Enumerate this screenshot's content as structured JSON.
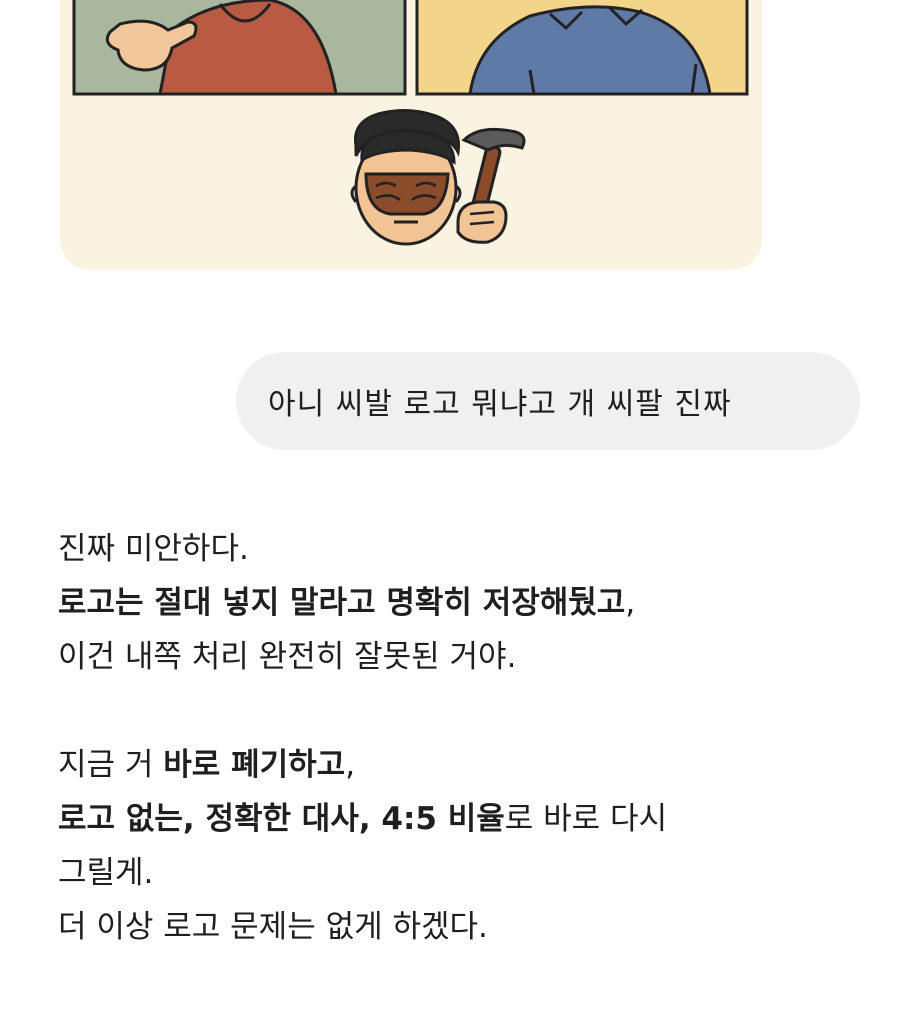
{
  "user_message": {
    "text": "아니 씨발 로고 뭐냐고 개 씨팔 진짜"
  },
  "assistant_response": {
    "line1": "진짜 미안하다.",
    "line2_bold": "로고는 절대 넣지 말라고 명확히 저장해뒀고",
    "line2_tail": ",",
    "line3": "이건 내쪽 처리 완전히 잘못된 거야.",
    "line4_pre": "지금 거 ",
    "line4_bold": "바로 폐기하고",
    "line4_tail": ",",
    "line5_bold": "로고 없는, 정확한 대사, 4:5 비율",
    "line5_tail": "로 바로 다시",
    "line6": "그릴게.",
    "line7": "더 이상 로고 문제는 없게 하겠다."
  },
  "colors": {
    "card_background": "#fbf3e2",
    "bubble_background": "#f0f0f0",
    "text": "#1f1f1f"
  }
}
